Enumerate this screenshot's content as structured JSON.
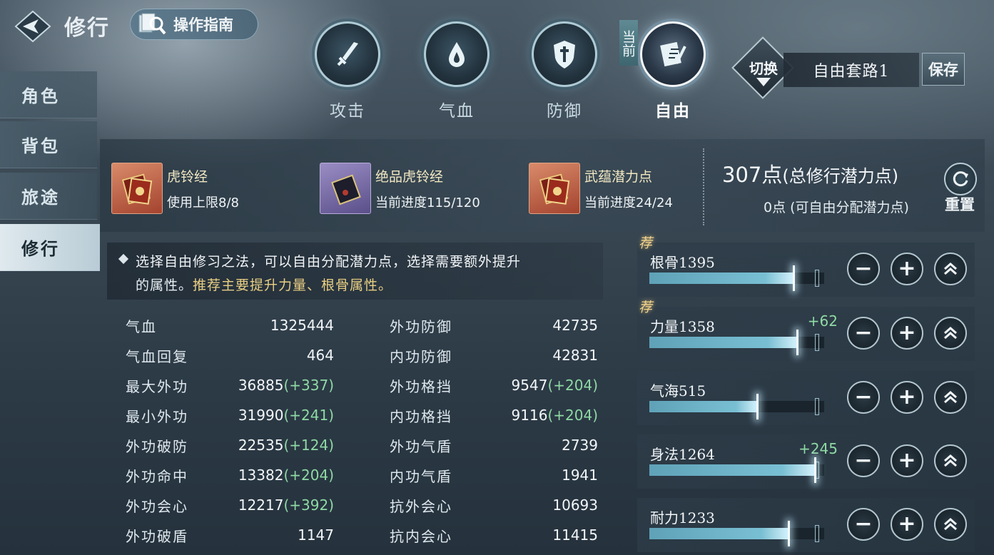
{
  "header": {
    "title": "修行",
    "guide_label": "操作指南"
  },
  "categories": [
    {
      "label": "攻击",
      "icon": "sword-icon"
    },
    {
      "label": "气血",
      "icon": "blood-drop-icon"
    },
    {
      "label": "防御",
      "icon": "shield-icon"
    },
    {
      "label": "自由",
      "icon": "book-brush-icon"
    }
  ],
  "current_tag": "当前",
  "preset": {
    "switch_label": "切换",
    "name": "自由套路1",
    "save_label": "保存"
  },
  "sidebar": {
    "items": [
      {
        "label": "角色"
      },
      {
        "label": "背包"
      },
      {
        "label": "旅途"
      },
      {
        "label": "修行"
      }
    ]
  },
  "resources": [
    {
      "name": "虎铃经",
      "progress": "使用上限8/8"
    },
    {
      "name": "绝品虎铃经",
      "progress": "当前进度115/120"
    },
    {
      "name": "武蕴潜力点",
      "progress": "当前进度24/24"
    }
  ],
  "points": {
    "total_value": "307点",
    "total_label": "(总修行潜力点)",
    "free": "0点 (可自由分配潜力点)",
    "reset_label": "重置"
  },
  "tip": {
    "line1": "选择自由修习之法，可以自由分配潜力点，选择需要额外提升",
    "line2_prefix": "的属性。",
    "line2_highlight": "推荐主要提升力量、根骨属性。"
  },
  "stats_left": [
    {
      "label": "气血",
      "value": "1325444",
      "bonus": ""
    },
    {
      "label": "气血回复",
      "value": "464",
      "bonus": ""
    },
    {
      "label": "最大外功",
      "value": "36885",
      "bonus": "(+337)"
    },
    {
      "label": "最小外功",
      "value": "31990",
      "bonus": "(+241)"
    },
    {
      "label": "外功破防",
      "value": "22535",
      "bonus": "(+124)"
    },
    {
      "label": "外功命中",
      "value": "13382",
      "bonus": "(+204)"
    },
    {
      "label": "外功会心",
      "value": "12217",
      "bonus": "(+392)"
    },
    {
      "label": "外功破盾",
      "value": "1147",
      "bonus": ""
    }
  ],
  "stats_right": [
    {
      "label": "外功防御",
      "value": "42735",
      "bonus": ""
    },
    {
      "label": "内功防御",
      "value": "42831",
      "bonus": ""
    },
    {
      "label": "外功格挡",
      "value": "9547",
      "bonus": "(+204)"
    },
    {
      "label": "内功格挡",
      "value": "9116",
      "bonus": "(+204)"
    },
    {
      "label": "外功气盾",
      "value": "2739",
      "bonus": ""
    },
    {
      "label": "内功气盾",
      "value": "1941",
      "bonus": ""
    },
    {
      "label": "抗外会心",
      "value": "10693",
      "bonus": ""
    },
    {
      "label": "抗内会心",
      "value": "11415",
      "bonus": ""
    }
  ],
  "attributes": [
    {
      "name": "根骨1395",
      "bonus": "",
      "recommended": "荐",
      "fill": 0.83
    },
    {
      "name": "力量1358",
      "bonus": "+62",
      "recommended": "荐",
      "fill": 0.85
    },
    {
      "name": "气海515",
      "bonus": "",
      "recommended": "",
      "fill": 0.62
    },
    {
      "name": "身法1264",
      "bonus": "+245",
      "recommended": "",
      "fill": 0.95
    },
    {
      "name": "耐力1233",
      "bonus": "",
      "recommended": "",
      "fill": 0.8
    }
  ],
  "controls": {
    "minus": "−",
    "plus": "+"
  }
}
